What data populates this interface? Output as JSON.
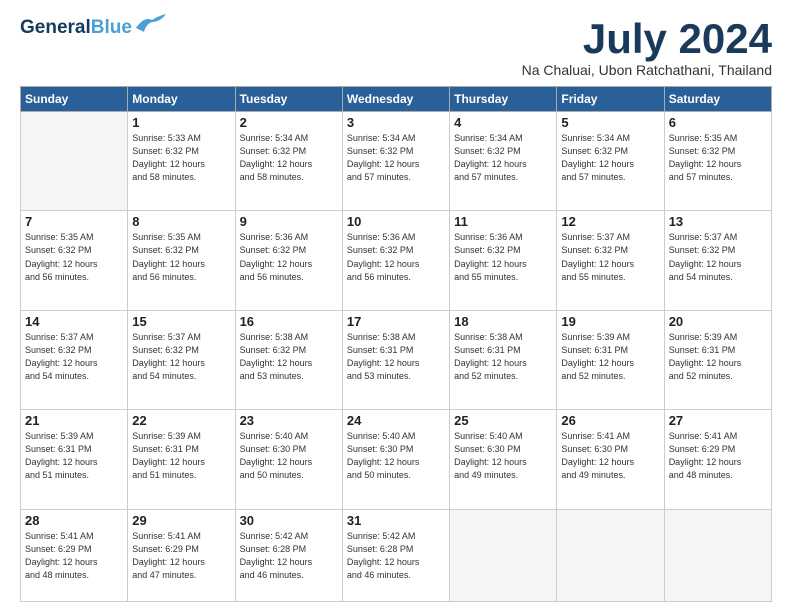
{
  "header": {
    "logo_line1": "General",
    "logo_line2": "Blue",
    "month_title": "July 2024",
    "location": "Na Chaluai, Ubon Ratchathani, Thailand"
  },
  "weekdays": [
    "Sunday",
    "Monday",
    "Tuesday",
    "Wednesday",
    "Thursday",
    "Friday",
    "Saturday"
  ],
  "weeks": [
    [
      {
        "day": "",
        "info": ""
      },
      {
        "day": "1",
        "info": "Sunrise: 5:33 AM\nSunset: 6:32 PM\nDaylight: 12 hours\nand 58 minutes."
      },
      {
        "day": "2",
        "info": "Sunrise: 5:34 AM\nSunset: 6:32 PM\nDaylight: 12 hours\nand 58 minutes."
      },
      {
        "day": "3",
        "info": "Sunrise: 5:34 AM\nSunset: 6:32 PM\nDaylight: 12 hours\nand 57 minutes."
      },
      {
        "day": "4",
        "info": "Sunrise: 5:34 AM\nSunset: 6:32 PM\nDaylight: 12 hours\nand 57 minutes."
      },
      {
        "day": "5",
        "info": "Sunrise: 5:34 AM\nSunset: 6:32 PM\nDaylight: 12 hours\nand 57 minutes."
      },
      {
        "day": "6",
        "info": "Sunrise: 5:35 AM\nSunset: 6:32 PM\nDaylight: 12 hours\nand 57 minutes."
      }
    ],
    [
      {
        "day": "7",
        "info": "Sunrise: 5:35 AM\nSunset: 6:32 PM\nDaylight: 12 hours\nand 56 minutes."
      },
      {
        "day": "8",
        "info": "Sunrise: 5:35 AM\nSunset: 6:32 PM\nDaylight: 12 hours\nand 56 minutes."
      },
      {
        "day": "9",
        "info": "Sunrise: 5:36 AM\nSunset: 6:32 PM\nDaylight: 12 hours\nand 56 minutes."
      },
      {
        "day": "10",
        "info": "Sunrise: 5:36 AM\nSunset: 6:32 PM\nDaylight: 12 hours\nand 56 minutes."
      },
      {
        "day": "11",
        "info": "Sunrise: 5:36 AM\nSunset: 6:32 PM\nDaylight: 12 hours\nand 55 minutes."
      },
      {
        "day": "12",
        "info": "Sunrise: 5:37 AM\nSunset: 6:32 PM\nDaylight: 12 hours\nand 55 minutes."
      },
      {
        "day": "13",
        "info": "Sunrise: 5:37 AM\nSunset: 6:32 PM\nDaylight: 12 hours\nand 54 minutes."
      }
    ],
    [
      {
        "day": "14",
        "info": "Sunrise: 5:37 AM\nSunset: 6:32 PM\nDaylight: 12 hours\nand 54 minutes."
      },
      {
        "day": "15",
        "info": "Sunrise: 5:37 AM\nSunset: 6:32 PM\nDaylight: 12 hours\nand 54 minutes."
      },
      {
        "day": "16",
        "info": "Sunrise: 5:38 AM\nSunset: 6:32 PM\nDaylight: 12 hours\nand 53 minutes."
      },
      {
        "day": "17",
        "info": "Sunrise: 5:38 AM\nSunset: 6:31 PM\nDaylight: 12 hours\nand 53 minutes."
      },
      {
        "day": "18",
        "info": "Sunrise: 5:38 AM\nSunset: 6:31 PM\nDaylight: 12 hours\nand 52 minutes."
      },
      {
        "day": "19",
        "info": "Sunrise: 5:39 AM\nSunset: 6:31 PM\nDaylight: 12 hours\nand 52 minutes."
      },
      {
        "day": "20",
        "info": "Sunrise: 5:39 AM\nSunset: 6:31 PM\nDaylight: 12 hours\nand 52 minutes."
      }
    ],
    [
      {
        "day": "21",
        "info": "Sunrise: 5:39 AM\nSunset: 6:31 PM\nDaylight: 12 hours\nand 51 minutes."
      },
      {
        "day": "22",
        "info": "Sunrise: 5:39 AM\nSunset: 6:31 PM\nDaylight: 12 hours\nand 51 minutes."
      },
      {
        "day": "23",
        "info": "Sunrise: 5:40 AM\nSunset: 6:30 PM\nDaylight: 12 hours\nand 50 minutes."
      },
      {
        "day": "24",
        "info": "Sunrise: 5:40 AM\nSunset: 6:30 PM\nDaylight: 12 hours\nand 50 minutes."
      },
      {
        "day": "25",
        "info": "Sunrise: 5:40 AM\nSunset: 6:30 PM\nDaylight: 12 hours\nand 49 minutes."
      },
      {
        "day": "26",
        "info": "Sunrise: 5:41 AM\nSunset: 6:30 PM\nDaylight: 12 hours\nand 49 minutes."
      },
      {
        "day": "27",
        "info": "Sunrise: 5:41 AM\nSunset: 6:29 PM\nDaylight: 12 hours\nand 48 minutes."
      }
    ],
    [
      {
        "day": "28",
        "info": "Sunrise: 5:41 AM\nSunset: 6:29 PM\nDaylight: 12 hours\nand 48 minutes."
      },
      {
        "day": "29",
        "info": "Sunrise: 5:41 AM\nSunset: 6:29 PM\nDaylight: 12 hours\nand 47 minutes."
      },
      {
        "day": "30",
        "info": "Sunrise: 5:42 AM\nSunset: 6:28 PM\nDaylight: 12 hours\nand 46 minutes."
      },
      {
        "day": "31",
        "info": "Sunrise: 5:42 AM\nSunset: 6:28 PM\nDaylight: 12 hours\nand 46 minutes."
      },
      {
        "day": "",
        "info": ""
      },
      {
        "day": "",
        "info": ""
      },
      {
        "day": "",
        "info": ""
      }
    ]
  ]
}
